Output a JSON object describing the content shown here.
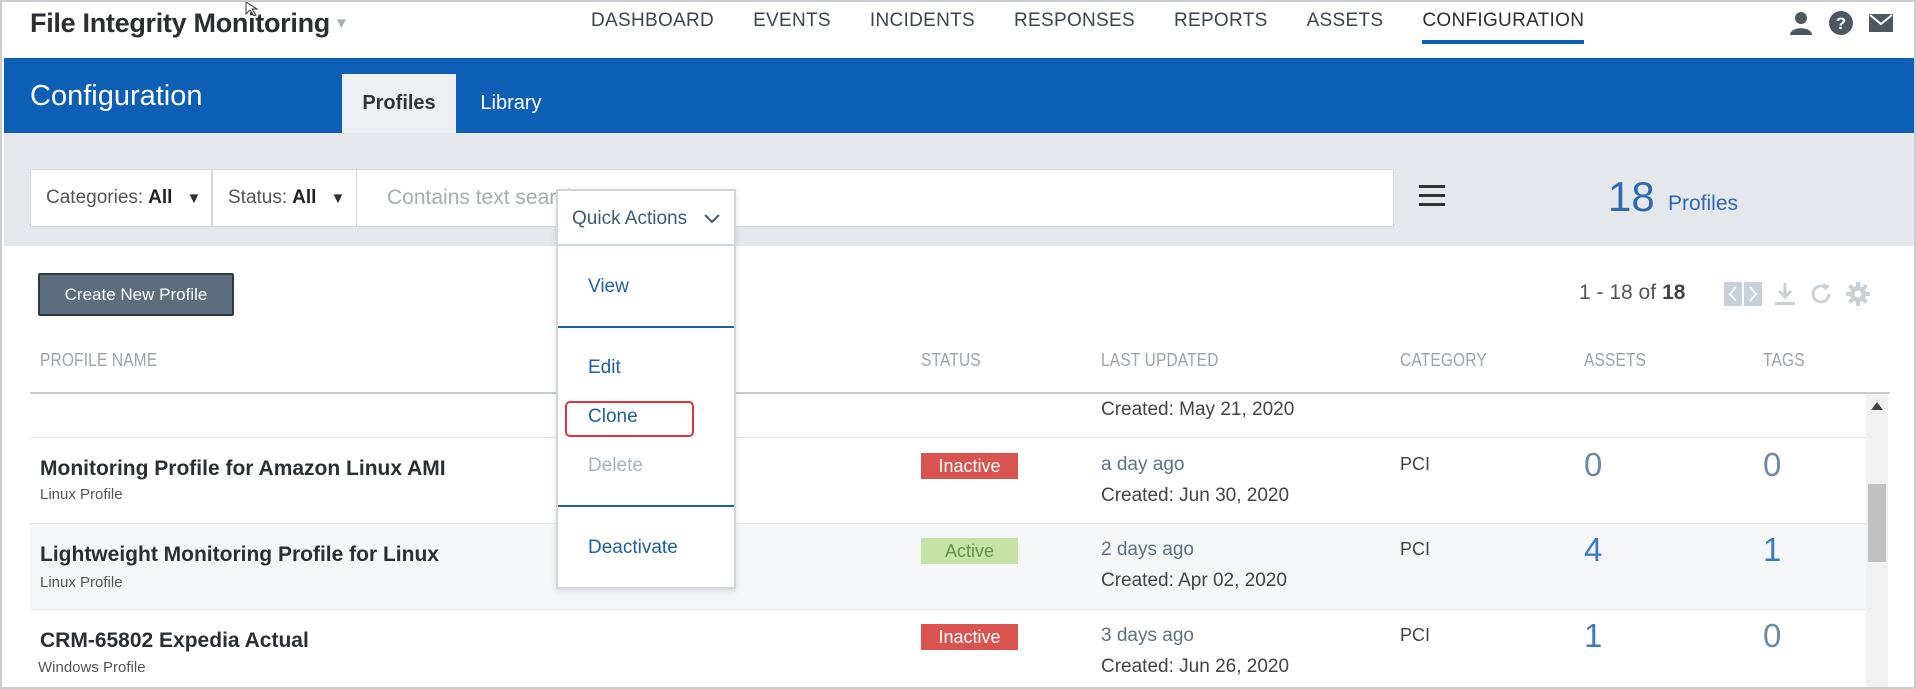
{
  "app": {
    "title": "File Integrity Monitoring"
  },
  "nav": [
    "DASHBOARD",
    "EVENTS",
    "INCIDENTS",
    "RESPONSES",
    "REPORTS",
    "ASSETS",
    "CONFIGURATION"
  ],
  "header": {
    "title": "Configuration",
    "tabs": [
      "Profiles",
      "Library"
    ],
    "active_tab": "Profiles"
  },
  "filters": {
    "categories_label": "Categories:",
    "categories_value": "All",
    "status_label": "Status:",
    "status_value": "All",
    "search_placeholder": "Contains text search"
  },
  "summary": {
    "count": "18",
    "label": "Profiles"
  },
  "toolbar": {
    "create_label": "Create New Profile",
    "pager_range": "1 - 18 of",
    "pager_total": "18"
  },
  "columns": [
    "PROFILE NAME",
    "STATUS",
    "LAST UPDATED",
    "CATEGORY",
    "ASSETS",
    "TAGS"
  ],
  "partial_row": {
    "created": "Created: May 21, 2020"
  },
  "rows": [
    {
      "name": "Monitoring Profile for Amazon Linux AMI",
      "type": "Linux Profile",
      "status": "Inactive",
      "updated": "a day ago",
      "created": "Created: Jun 30, 2020",
      "category": "PCI",
      "assets": "0",
      "tags": "0"
    },
    {
      "name": "Lightweight Monitoring Profile for Linux",
      "type": "Linux Profile",
      "status": "Active",
      "updated": "2 days ago",
      "created": "Created: Apr 02, 2020",
      "category": "PCI",
      "assets": "4",
      "tags": "1"
    },
    {
      "name": "CRM-65802 Expedia Actual",
      "type": "Windows Profile",
      "status": "Inactive",
      "updated": "3 days ago",
      "created": "Created: Jun 26, 2020",
      "category": "PCI",
      "assets": "1",
      "tags": "0"
    }
  ],
  "quick_actions": {
    "label": "Quick Actions",
    "items": [
      "View",
      "Edit",
      "Clone",
      "Delete",
      "Deactivate"
    ],
    "disabled": [
      "Delete"
    ],
    "highlighted": "Clone"
  },
  "colors": {
    "brand_blue": "#0d5fb5",
    "inactive_red": "#d9534f",
    "active_green": "#c5e3a4",
    "highlight_red": "#e0343b"
  }
}
